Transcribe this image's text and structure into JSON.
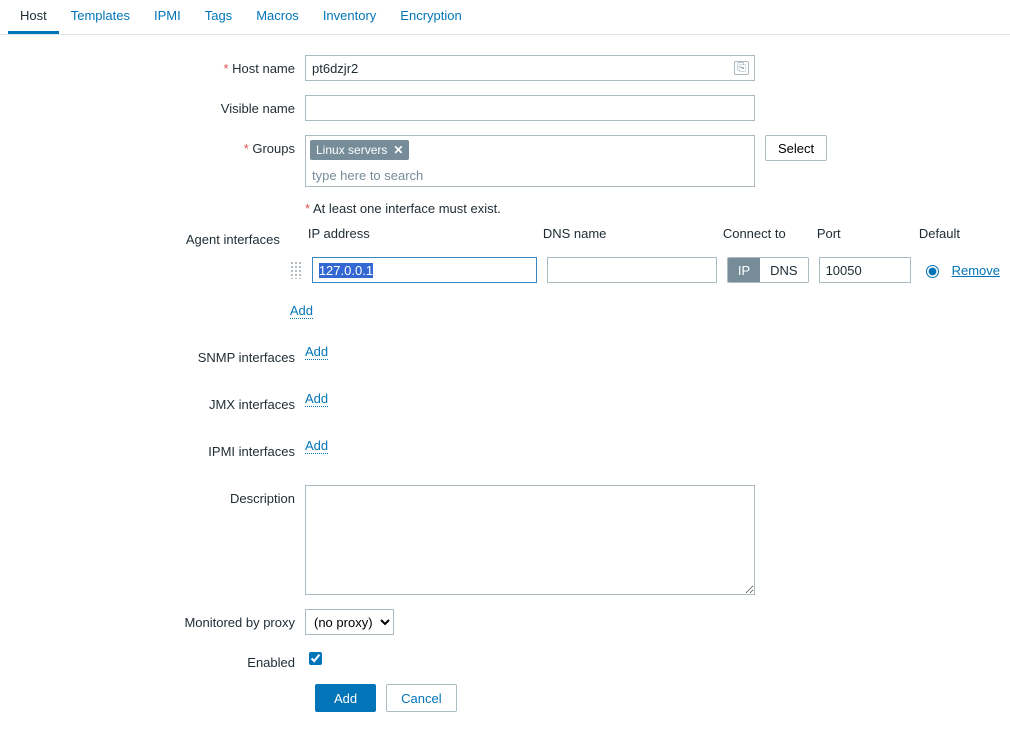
{
  "tabs": [
    {
      "label": "Host",
      "active": true
    },
    {
      "label": "Templates",
      "active": false
    },
    {
      "label": "IPMI",
      "active": false
    },
    {
      "label": "Tags",
      "active": false
    },
    {
      "label": "Macros",
      "active": false
    },
    {
      "label": "Inventory",
      "active": false
    },
    {
      "label": "Encryption",
      "active": false
    }
  ],
  "labels": {
    "host_name": "Host name",
    "visible_name": "Visible name",
    "groups": "Groups",
    "select": "Select",
    "at_least": "At least one interface must exist.",
    "agent_interfaces": "Agent interfaces",
    "snmp_interfaces": "SNMP interfaces",
    "jmx_interfaces": "JMX interfaces",
    "ipmi_interfaces": "IPMI interfaces",
    "description": "Description",
    "monitored_by_proxy": "Monitored by proxy",
    "enabled": "Enabled",
    "add": "Add",
    "cancel": "Cancel",
    "remove": "Remove",
    "ip_address": "IP address",
    "dns_name": "DNS name",
    "connect_to": "Connect to",
    "port": "Port",
    "default": "Default",
    "ip": "IP",
    "dns": "DNS"
  },
  "hostname": "pt6dzjr2",
  "visible_name": "",
  "groups": {
    "chips": [
      {
        "label": "Linux servers"
      }
    ],
    "placeholder": "type here to search"
  },
  "agent_interface": {
    "ip": "127.0.0.1",
    "dns": "",
    "connect_to": "IP",
    "port": "10050",
    "default": true
  },
  "description": "",
  "proxy_options": [
    "(no proxy)"
  ],
  "proxy_selected": "(no proxy)",
  "enabled": true
}
